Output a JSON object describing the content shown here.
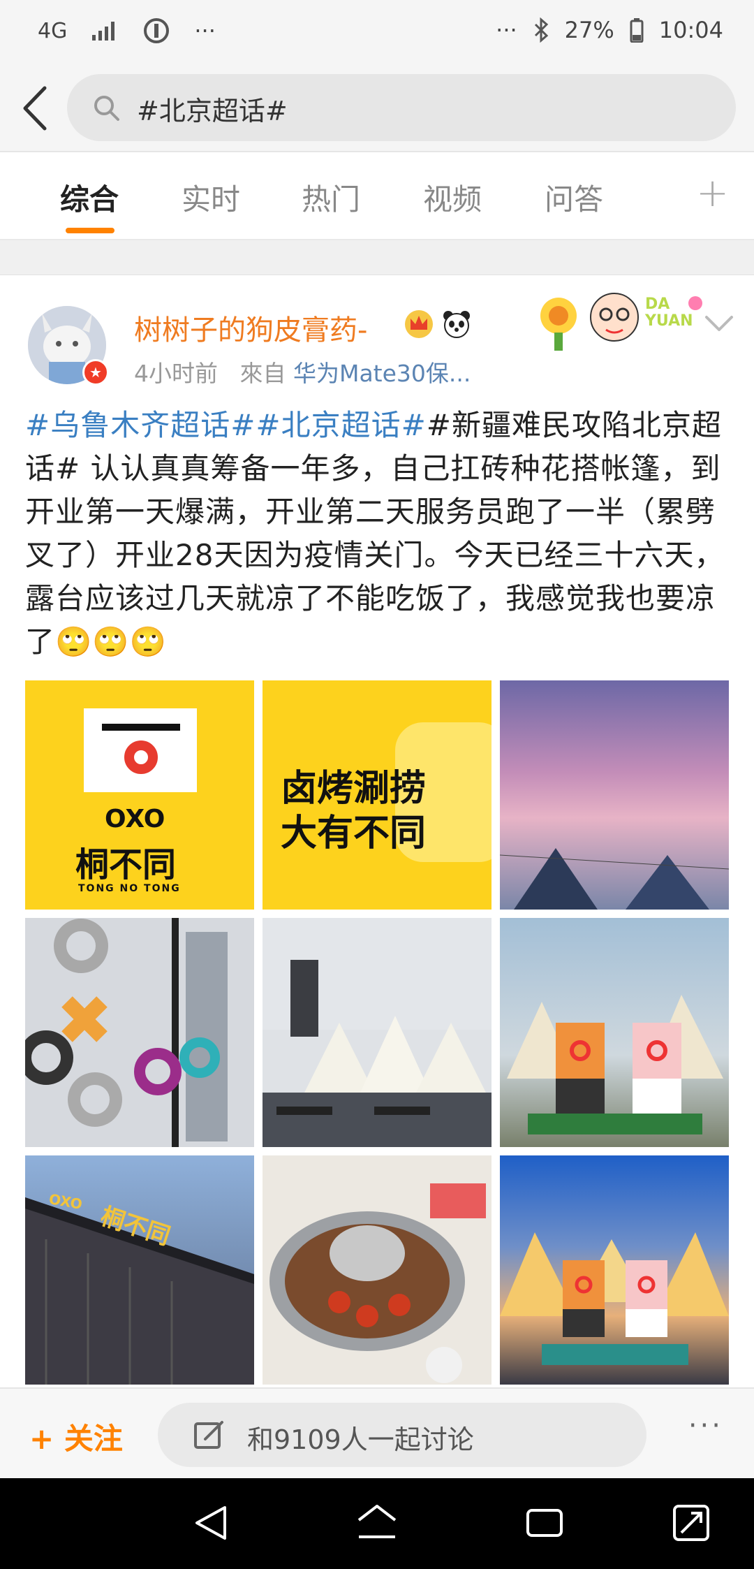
{
  "status_bar": {
    "network": "4G",
    "dots_left": "···",
    "dots_right": "···",
    "battery": "27%",
    "time": "10:04"
  },
  "search": {
    "query": "#北京超话#"
  },
  "tabs": [
    {
      "label": "综合",
      "active": true
    },
    {
      "label": "实时",
      "active": false
    },
    {
      "label": "热门",
      "active": false
    },
    {
      "label": "视频",
      "active": false
    },
    {
      "label": "问答",
      "active": false
    }
  ],
  "tabs_more": "+",
  "post": {
    "username": "树树子的狗皮膏药-",
    "time": "4小时前",
    "source_prefix": "來自",
    "device": "华为Mate30保...",
    "deco_text": "DA YUAN",
    "hashtags": [
      "#乌鲁木齐超话#",
      "#北京超话#"
    ],
    "body": "#新疆难民攻陷北京超话# 认认真真筹备一年多，自己扛砖种花搭帐篷，到开业第一天爆满，开业第二天服务员跑了一半（累劈叉了）开业28天因为疫情关门。今天已经三十六天，露台应该过几天就凉了不能吃饭了，我感觉我也要凉了",
    "emoji": "🙄🙄🙄",
    "images": [
      {
        "title": "桐不同",
        "subtitle": "TONG NO TONG",
        "logo": "OXO"
      },
      {
        "line1": "卤烤涮捞",
        "line2": "大有不同"
      },
      {
        "desc": "sunset sky"
      },
      {
        "desc": "window with XO sculptures"
      },
      {
        "desc": "rooftop tents daytime"
      },
      {
        "desc": "mascots in front of tents"
      },
      {
        "sign": "桐不同",
        "sign_logo": "OXO"
      },
      {
        "desc": "hotpot table"
      },
      {
        "desc": "mascots at night"
      }
    ]
  },
  "bottom_bar": {
    "follow_label": "关注",
    "follow_plus": "+",
    "discuss_label": "和9109人一起讨论",
    "more": "···"
  },
  "colors": {
    "accent": "#ff8200",
    "link": "#3a7fc2",
    "username": "#ef7b20",
    "yellow": "#fdd21d"
  }
}
